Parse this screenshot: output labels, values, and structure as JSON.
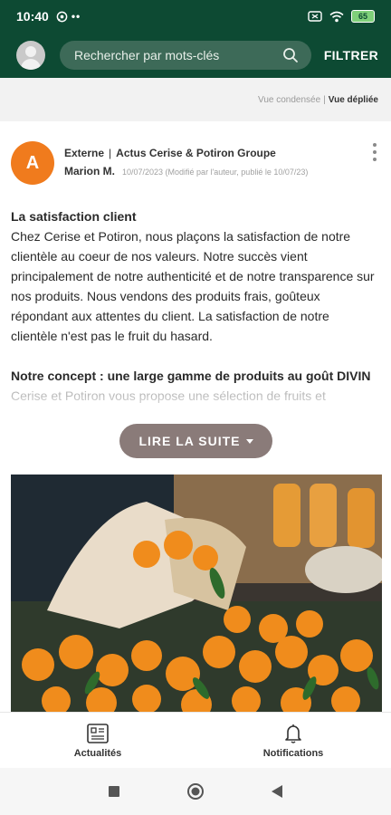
{
  "status_bar": {
    "time": "10:40",
    "battery": "65",
    "icons": [
      "whatsapp-icon",
      "more-dots-icon",
      "sim-icon",
      "wifi-icon",
      "battery-icon"
    ]
  },
  "app_bar": {
    "search_placeholder": "Rechercher par mots-clés",
    "filter_label": "FILTRER"
  },
  "view_toggle": {
    "condensed": "Vue condensée",
    "separator": "|",
    "expanded": "Vue dépliée"
  },
  "post": {
    "avatar_letter": "A",
    "source": "Externe",
    "separator": "|",
    "group": "Actus Cerise & Potiron Groupe",
    "author": "Marion M.",
    "date": "10/07/2023 (Modifié par l'auteur, publié le 10/07/23)",
    "title": "La satisfaction client",
    "paragraph": "Chez Cerise et Potiron, nous plaçons la satisfaction de notre clientèle au coeur de nos valeurs. Notre succès vient principalement de notre authenticité et de notre transparence sur nos produits. Nous vendons des produits frais, goûteux répondant aux attentes du client. La satisfaction de notre clientèle n'est pas le fruit du hasard.",
    "section2_title": "Notre concept : une large gamme de produits au goût DIVIN",
    "section2_text": "Cerise et Potiron vous propose une sélection de fruits et",
    "read_more": "LIRE LA SUITE"
  },
  "bottom_nav": {
    "items": [
      {
        "label": "Actualités",
        "icon": "news-icon"
      },
      {
        "label": "Notifications",
        "icon": "bell-icon"
      }
    ]
  },
  "colors": {
    "brand_green": "#0d4a33",
    "avatar_orange": "#f07b1d",
    "read_more_bg": "#8a7b79"
  }
}
